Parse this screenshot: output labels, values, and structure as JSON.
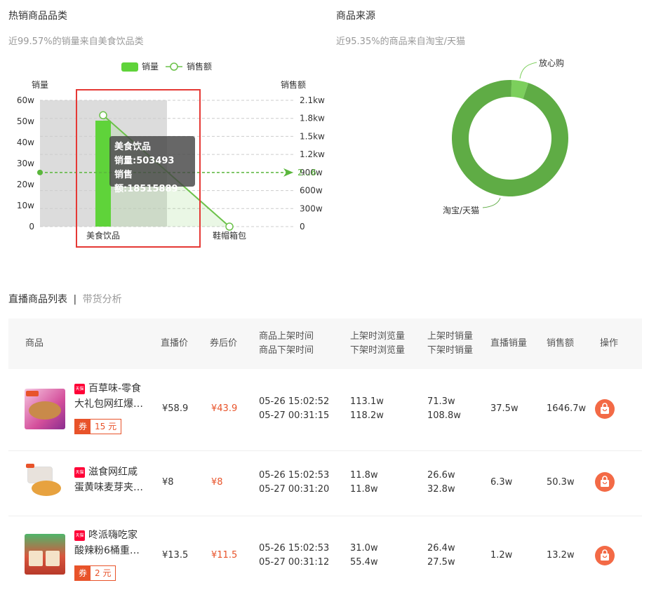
{
  "hot_category": {
    "title": "热销商品品类",
    "subtitle": "近99.57%的销量来自美食饮品类"
  },
  "source": {
    "title": "商品来源",
    "subtitle": "近95.35%的商品来自淘宝/天猫"
  },
  "chart_data": [
    {
      "type": "bar",
      "categories": [
        "美食饮品",
        "鞋帽箱包"
      ],
      "series": [
        {
          "name": "销量",
          "values": [
            503493,
            0
          ],
          "axis": "left"
        },
        {
          "name": "销售额",
          "type": "line",
          "values": [
            18515889,
            0
          ],
          "axis": "right"
        }
      ],
      "yleft": {
        "label": "销量",
        "ticks": [
          "0",
          "10w",
          "20w",
          "30w",
          "40w",
          "50w",
          "60w"
        ],
        "range": [
          0,
          600000
        ]
      },
      "yright": {
        "label": "销售额",
        "ticks": [
          "0",
          "300w",
          "600w",
          "900w",
          "1.2kw",
          "1.5kw",
          "1.8kw",
          "2.1kw"
        ],
        "range": [
          0,
          21000000
        ]
      },
      "avg_line_value_right": 9000000,
      "avg_line_label": "2...6",
      "legend": [
        "销量",
        "销售额"
      ],
      "legend_position": "top-center",
      "colors": {
        "bar": "#5fd33a",
        "line": "#6cc24a"
      },
      "tooltip": {
        "title": "美食饮品",
        "line1": "销量:503493",
        "line2": "销售额:18515889"
      }
    },
    {
      "type": "pie",
      "donut": true,
      "slices": [
        {
          "label": "淘宝/天猫",
          "value": 95.35,
          "color": "#5fac45"
        },
        {
          "label": "放心购",
          "value": 4.65,
          "color": "#7ccf5c"
        }
      ]
    }
  ],
  "list": {
    "tab_active": "直播商品列表",
    "tab_sep": "|",
    "tab_other": "带货分析",
    "headers": {
      "product": "商品",
      "live_price": "直播价",
      "coupon_price": "券后价",
      "time1": "商品上架时间",
      "time2": "商品下架时间",
      "views1": "上架时浏览量",
      "views2": "下架时浏览量",
      "sales1": "上架时销量",
      "sales2": "下架时销量",
      "live_sales": "直播销量",
      "revenue": "销售额",
      "action": "操作"
    },
    "tmall_badge": "天猫",
    "coupon_tag": "券",
    "rows": [
      {
        "name1": "百草味-零食",
        "name2": "大礼包网红爆…",
        "coupon": "15 元",
        "live_price": "¥58.9",
        "coupon_price": "¥43.9",
        "t_on": "05-26 15:02:52",
        "t_off": "05-27 00:31:15",
        "v_on": "113.1w",
        "v_off": "118.2w",
        "s_on": "71.3w",
        "s_off": "108.8w",
        "live_sales": "37.5w",
        "revenue": "1646.7w"
      },
      {
        "name1": "滋食网红咸",
        "name2": "蛋黄味麦芽夹…",
        "live_price": "¥8",
        "coupon_price": "¥8",
        "t_on": "05-26 15:02:53",
        "t_off": "05-27 00:31:20",
        "v_on": "11.8w",
        "v_off": "11.8w",
        "s_on": "26.6w",
        "s_off": "32.8w",
        "live_sales": "6.3w",
        "revenue": "50.3w"
      },
      {
        "name1": "咚派嗨吃家",
        "name2": "酸辣粉6桶重…",
        "coupon": "2 元",
        "live_price": "¥13.5",
        "coupon_price": "¥11.5",
        "t_on": "05-26 15:02:53",
        "t_off": "05-27 00:31:12",
        "v_on": "31.0w",
        "v_off": "55.4w",
        "s_on": "26.4w",
        "s_off": "27.5w",
        "live_sales": "1.2w",
        "revenue": "13.2w"
      }
    ]
  }
}
